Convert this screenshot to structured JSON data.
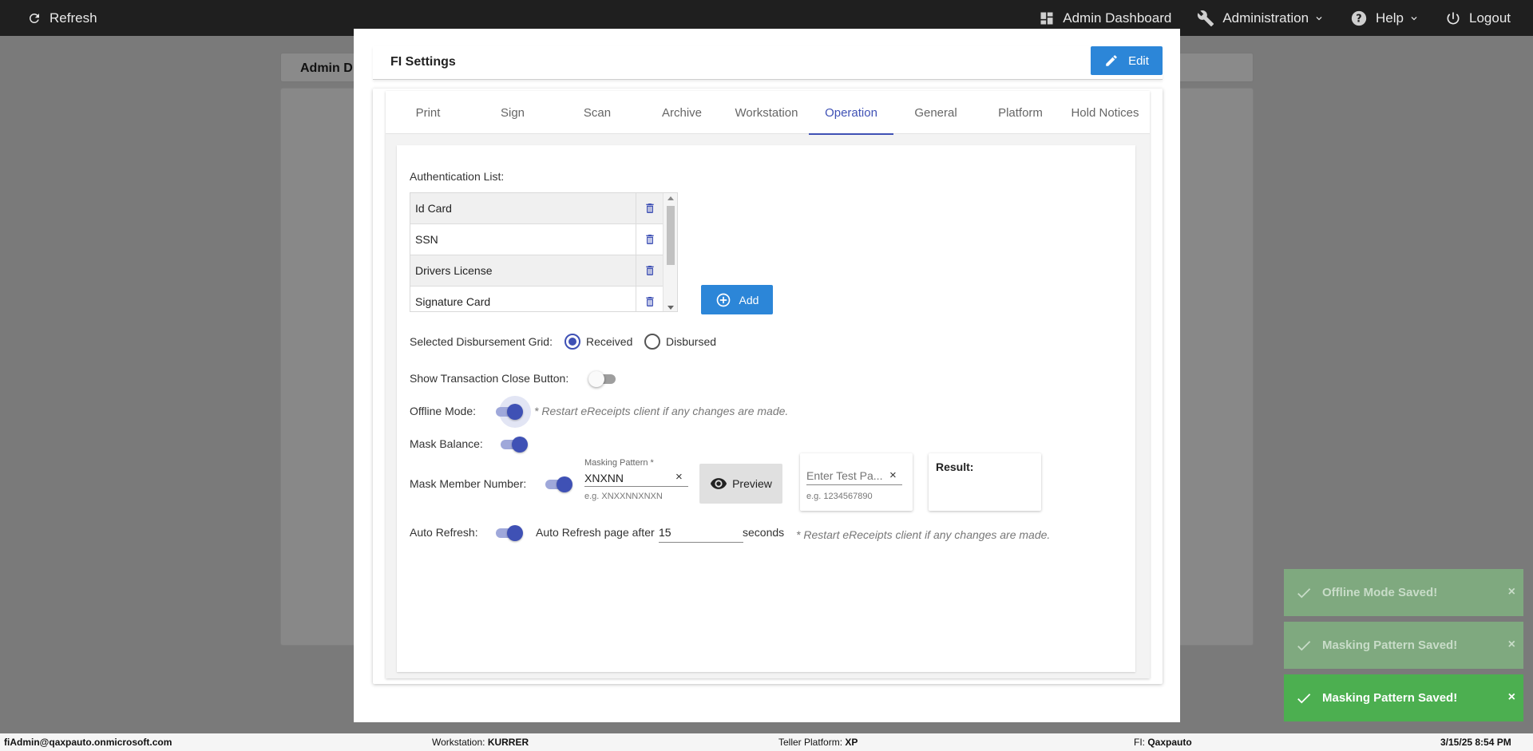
{
  "topbar": {
    "refresh_label": "Refresh",
    "admin_dashboard_label": "Admin Dashboard",
    "administration_label": "Administration",
    "help_label": "Help",
    "logout_label": "Logout"
  },
  "background": {
    "tab_label": "Admin D"
  },
  "modal": {
    "title": "FI Settings",
    "edit_label": "Edit",
    "tabs": [
      {
        "label": "Print"
      },
      {
        "label": "Sign"
      },
      {
        "label": "Scan"
      },
      {
        "label": "Archive"
      },
      {
        "label": "Workstation"
      },
      {
        "label": "Operation",
        "active": true
      },
      {
        "label": "General"
      },
      {
        "label": "Platform"
      },
      {
        "label": "Hold Notices"
      }
    ],
    "auth_list": {
      "label": "Authentication List:",
      "items": [
        "Id Card",
        "SSN",
        "Drivers License",
        "Signature Card"
      ],
      "add_label": "Add"
    },
    "disbursement": {
      "label": "Selected Disbursement Grid:",
      "options": [
        "Received",
        "Disbursed"
      ],
      "selected": "Received"
    },
    "transaction_close": {
      "label": "Show Transaction Close Button:",
      "enabled": false
    },
    "offline_mode": {
      "label": "Offline Mode:",
      "enabled": true,
      "note": "* Restart eReceipts client if any changes are made."
    },
    "mask_balance": {
      "label": "Mask Balance:",
      "enabled": true
    },
    "mask_member": {
      "label": "Mask Member Number:",
      "enabled": true,
      "pattern_label": "Masking Pattern *",
      "pattern_value": "XNXNN",
      "pattern_hint": "e.g. XNXXNNXNXN",
      "preview_label": "Preview",
      "test_placeholder": "Enter Test Pa...",
      "test_hint": "e.g. 1234567890",
      "result_label": "Result:"
    },
    "auto_refresh": {
      "label": "Auto Refresh:",
      "enabled": true,
      "after_label": "Auto Refresh page after",
      "seconds_value": "15",
      "seconds_label": "seconds",
      "note": "* Restart eReceipts client if any changes are made."
    }
  },
  "toasts": [
    {
      "message": "Offline Mode Saved!",
      "close": "×"
    },
    {
      "message": "Masking Pattern Saved!",
      "close": "×"
    },
    {
      "message": "Masking Pattern Saved!",
      "close": "×"
    }
  ],
  "statusbar": {
    "user": "fiAdmin@qaxpauto.onmicrosoft.com",
    "workstation_label": "Workstation:",
    "workstation_value": "KURRER",
    "platform_label": "Teller Platform:",
    "platform_value": "XP",
    "fi_label": "FI:",
    "fi_value": "Qaxpauto",
    "datetime": "3/15/25 8:54 PM"
  },
  "colors": {
    "accent": "#3f51b5",
    "button_blue": "#2c86d8",
    "toast_green": "#4caf50",
    "toast_faded": "#7fa97f"
  }
}
